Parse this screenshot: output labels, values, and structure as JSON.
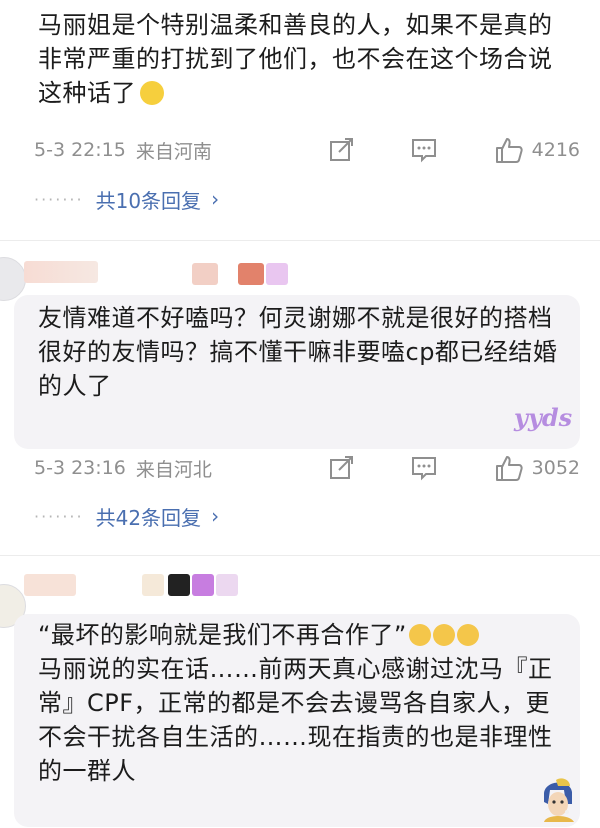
{
  "comments": [
    {
      "text": "马丽姐是个特别温柔和善良的人，如果不是真的非常严重的打扰到了他们，也不会在这个场合说这种话了",
      "emoji": "pleading-face-emoji",
      "time": "5-3 22:15",
      "location": "来自河南",
      "likes": "4216",
      "replies": "共10条回复"
    },
    {
      "text": "友情难道不好嗑吗？何灵谢娜不就是很好的搭档很好的友情吗？搞不懂干嘛非要嗑cp都已经结婚的人了",
      "sticker": "yyds",
      "time": "5-3 23:16",
      "location": "来自河北",
      "likes": "3052",
      "replies": "共42条回复"
    },
    {
      "text": "“最坏的影响就是我们不再合作了”",
      "text_rest": "马丽说的实在话……前两天真心感谢过沈马『正常』CPF，正常的都是不会去谩骂各自家人，更不会干扰各自生活的……现在指责的也是非理性的一群人",
      "emoji": "facepalm-emoji",
      "avatar_icon": "girl-with-pearl-earring-avatar"
    }
  ],
  "colors": {
    "meta": "#8f8f8f",
    "reply_link": "#4a6fb0",
    "bubble": "#f4f3f6"
  }
}
